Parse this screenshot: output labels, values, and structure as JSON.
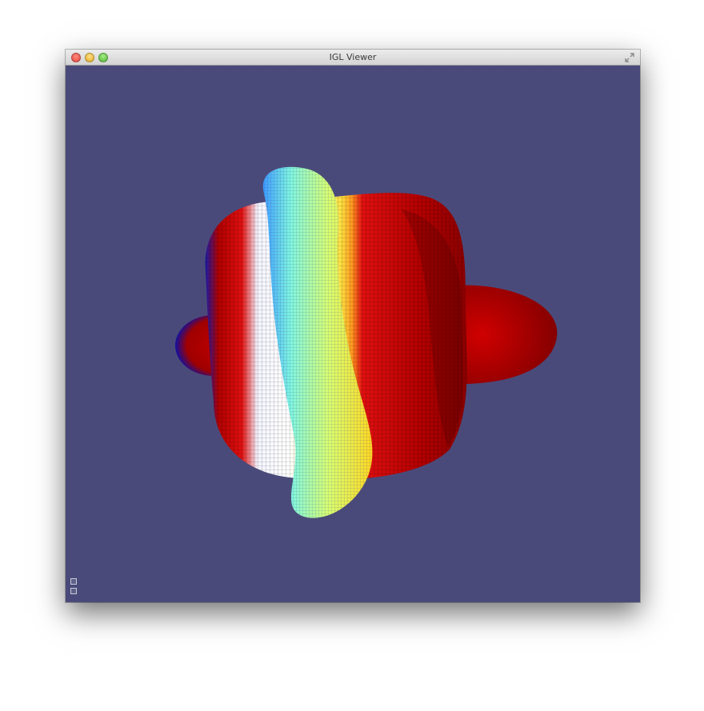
{
  "window": {
    "title": "IGL Viewer"
  },
  "scene": {
    "background_color": "#4a4a7a",
    "colormap": [
      "#0000b0",
      "#00e0ff",
      "#ffffff",
      "#ffff40",
      "#ff6000",
      "#cc0000"
    ]
  },
  "icons": {
    "close": "close-icon",
    "minimize": "minimize-icon",
    "zoom": "zoom-icon",
    "fullscreen": "fullscreen-icon",
    "toggle_a": "overlay-toggle-icon",
    "toggle_b": "overlay-toggle-icon"
  }
}
